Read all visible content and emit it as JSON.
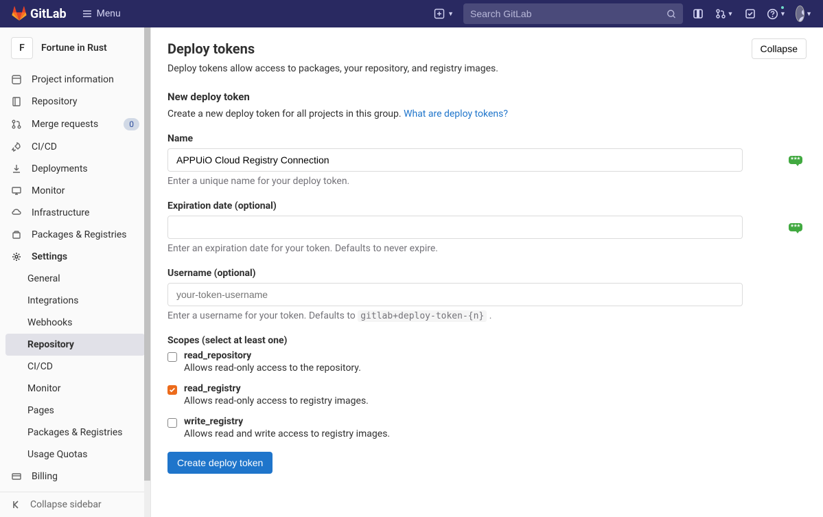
{
  "topnav": {
    "brand": "GitLab",
    "menu": "Menu",
    "search_placeholder": "Search GitLab"
  },
  "project": {
    "initial": "F",
    "name": "Fortune in Rust"
  },
  "sidebar": {
    "items": [
      {
        "label": "Project information"
      },
      {
        "label": "Repository"
      },
      {
        "label": "Merge requests",
        "badge": "0"
      },
      {
        "label": "CI/CD"
      },
      {
        "label": "Deployments"
      },
      {
        "label": "Monitor"
      },
      {
        "label": "Infrastructure"
      },
      {
        "label": "Packages & Registries"
      },
      {
        "label": "Settings"
      }
    ],
    "settings_sub": [
      {
        "label": "General"
      },
      {
        "label": "Integrations"
      },
      {
        "label": "Webhooks"
      },
      {
        "label": "Repository",
        "active": true
      },
      {
        "label": "CI/CD"
      },
      {
        "label": "Monitor"
      },
      {
        "label": "Pages"
      },
      {
        "label": "Packages & Registries"
      },
      {
        "label": "Usage Quotas"
      }
    ],
    "billing": "Billing",
    "collapse": "Collapse sidebar"
  },
  "page": {
    "title": "Deploy tokens",
    "collapse_btn": "Collapse",
    "subtitle": "Deploy tokens allow access to packages, your repository, and registry images.",
    "new_token_heading": "New deploy token",
    "new_token_desc": "Create a new deploy token for all projects in this group. ",
    "what_are_link": "What are deploy tokens?",
    "name_label": "Name",
    "name_value": "APPUiO Cloud Registry Connection",
    "name_help": "Enter a unique name for your deploy token.",
    "exp_label": "Expiration date (optional)",
    "exp_value": "",
    "exp_help": "Enter an expiration date for your token. Defaults to never expire.",
    "user_label": "Username (optional)",
    "user_placeholder": "your-token-username",
    "user_help_pre": "Enter a username for your token. Defaults to ",
    "user_help_code": "gitlab+deploy-token-{n}",
    "user_help_post": " .",
    "scopes_label": "Scopes (select at least one)",
    "scopes": [
      {
        "name": "read_repository",
        "desc": "Allows read-only access to the repository.",
        "checked": false
      },
      {
        "name": "read_registry",
        "desc": "Allows read-only access to registry images.",
        "checked": true
      },
      {
        "name": "write_registry",
        "desc": "Allows read and write access to registry images.",
        "checked": false
      }
    ],
    "create_btn": "Create deploy token"
  }
}
